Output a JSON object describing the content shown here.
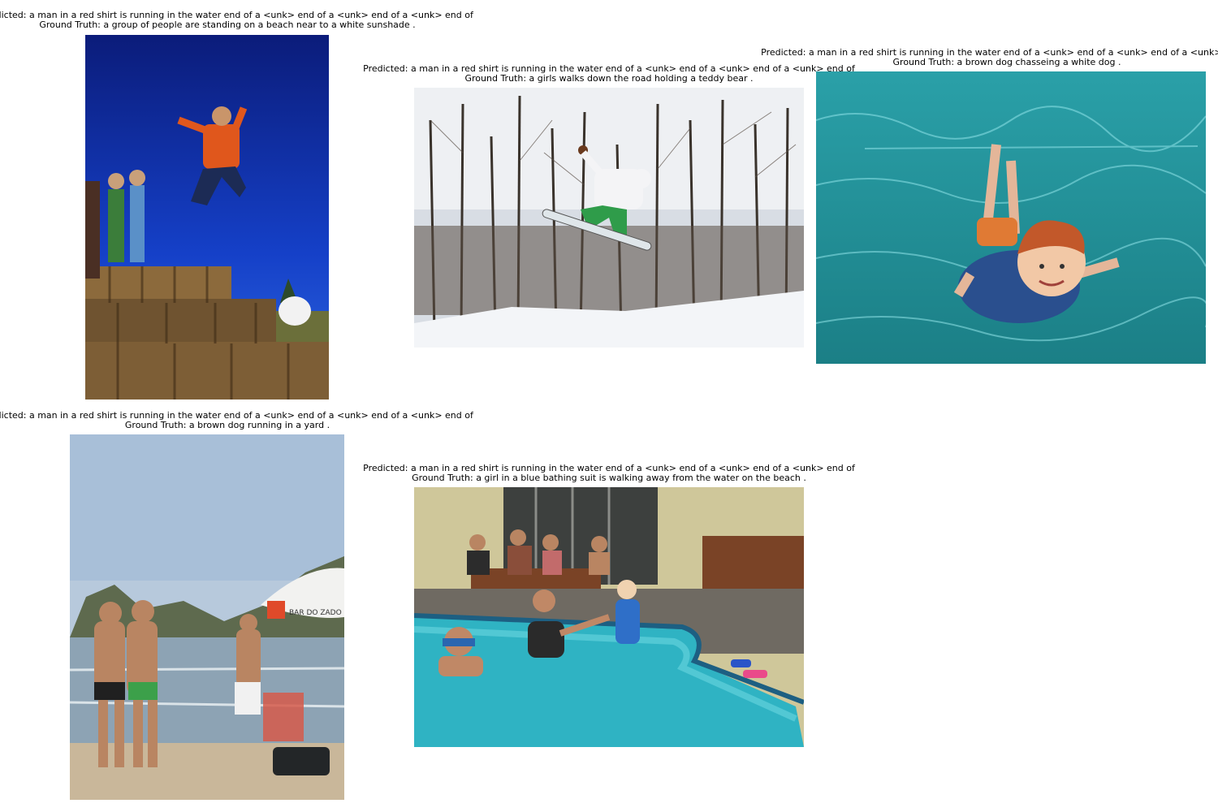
{
  "panels": [
    {
      "predicted": "Predicted: a man in a red shirt is running in the water end of a <unk> end of a <unk> end of a <unk> end of",
      "ground_truth": "Ground Truth: a group of people are standing on a beach near to a white sunshade ."
    },
    {
      "predicted": "Predicted: a man in a red shirt is running in the water end of a <unk> end of a <unk> end of a <unk> end of",
      "ground_truth": "Ground Truth: a girls walks down the road holding a teddy bear ."
    },
    {
      "predicted": "Predicted: a man in a red shirt is running in the water end of a <unk> end of a <unk> end of a <unk> end of",
      "ground_truth": "Ground Truth: a brown dog chasseing a white dog ."
    },
    {
      "predicted": "Predicted: a man in a red shirt is running in the water end of a <unk> end of a <unk> end of a <unk> end of",
      "ground_truth": "Ground Truth: a brown dog running in a yard ."
    },
    {
      "predicted": "Predicted: a man in a red shirt is running in the water end of a <unk> end of a <unk> end of a <unk> end of",
      "ground_truth": "Ground Truth: a girl in a blue bathing suit is walking away from the water on the beach ."
    }
  ],
  "photo_signs": {
    "beach_umbrella_text": "BAR DO ZADO"
  }
}
